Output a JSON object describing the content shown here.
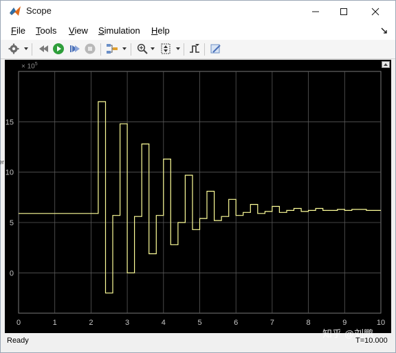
{
  "window": {
    "title": "Scope"
  },
  "menu": [
    {
      "key": "F",
      "rest": "ile"
    },
    {
      "key": "T",
      "rest": "ools"
    },
    {
      "key": "V",
      "rest": "iew"
    },
    {
      "key": "S",
      "rest": "imulation"
    },
    {
      "key": "H",
      "rest": "elp"
    }
  ],
  "toolbar": {
    "icons": [
      "gear-icon",
      "step-back-icon",
      "run-icon",
      "step-forward-icon",
      "stop-icon",
      "signal-select-icon",
      "zoom-icon",
      "autoscale-icon",
      "trigger-icon",
      "highlight-icon"
    ]
  },
  "axes": {
    "exponent_base": "× 10",
    "exponent_power": "5",
    "left_label_fragment": "er"
  },
  "status": {
    "text": "Ready",
    "time": "T=10.000"
  },
  "watermark": "知乎 @刘鹏",
  "colors": {
    "plot_bg": "#000000",
    "grid": "#5a5a5a",
    "signal": "#ffff9a",
    "tick_text": "#c8c8c8"
  },
  "chart_data": {
    "type": "line",
    "step": true,
    "xlim": [
      0,
      10
    ],
    "ylim": [
      -4,
      20
    ],
    "ylim_scale_note": "",
    "xticks": [
      0,
      1,
      2,
      3,
      4,
      5,
      6,
      7,
      8,
      9,
      10
    ],
    "yticks": [
      0,
      5,
      10,
      15
    ],
    "grid": true,
    "series": [
      {
        "x": [
          0,
          2.2,
          2.2,
          2.4,
          2.4,
          2.6,
          2.6,
          2.8,
          2.8,
          3.0,
          3.0,
          3.2,
          3.2,
          3.4,
          3.4,
          3.6,
          3.6,
          3.8,
          3.8,
          4.0,
          4.0,
          4.2,
          4.2,
          4.4,
          4.4,
          4.6,
          4.6,
          4.8,
          4.8,
          5.0,
          5.0,
          5.2,
          5.2,
          5.4,
          5.4,
          5.6,
          5.6,
          5.8,
          5.8,
          6.0,
          6.0,
          6.2,
          6.2,
          6.4,
          6.4,
          6.6,
          6.6,
          6.8,
          6.8,
          7.0,
          7.0,
          7.2,
          7.2,
          7.4,
          7.4,
          7.6,
          7.6,
          7.8,
          7.8,
          8.0,
          8.0,
          8.2,
          8.2,
          8.4,
          8.4,
          8.6,
          8.6,
          8.8,
          8.8,
          9.0,
          9.0,
          9.2,
          9.2,
          9.4,
          9.4,
          9.6,
          9.6,
          9.8,
          9.8,
          10.0
        ],
        "y": [
          5.9,
          5.9,
          17.0,
          17.0,
          -2.0,
          -2.0,
          5.7,
          5.7,
          14.8,
          14.8,
          0.0,
          0.0,
          5.6,
          5.6,
          12.8,
          12.8,
          1.9,
          1.9,
          5.7,
          5.7,
          11.3,
          11.3,
          2.8,
          2.8,
          5.0,
          5.0,
          9.7,
          9.7,
          4.3,
          4.3,
          5.4,
          5.4,
          8.1,
          8.1,
          5.2,
          5.2,
          5.6,
          5.6,
          7.3,
          7.3,
          5.7,
          5.7,
          6.0,
          6.0,
          6.8,
          6.8,
          5.9,
          5.9,
          6.1,
          6.1,
          6.6,
          6.6,
          6.0,
          6.0,
          6.2,
          6.2,
          6.4,
          6.4,
          6.1,
          6.1,
          6.2,
          6.2,
          6.4,
          6.4,
          6.2,
          6.2,
          6.2,
          6.2,
          6.3,
          6.3,
          6.2,
          6.2,
          6.3,
          6.3,
          6.3,
          6.3,
          6.2,
          6.2,
          6.2,
          6.2
        ]
      }
    ]
  }
}
